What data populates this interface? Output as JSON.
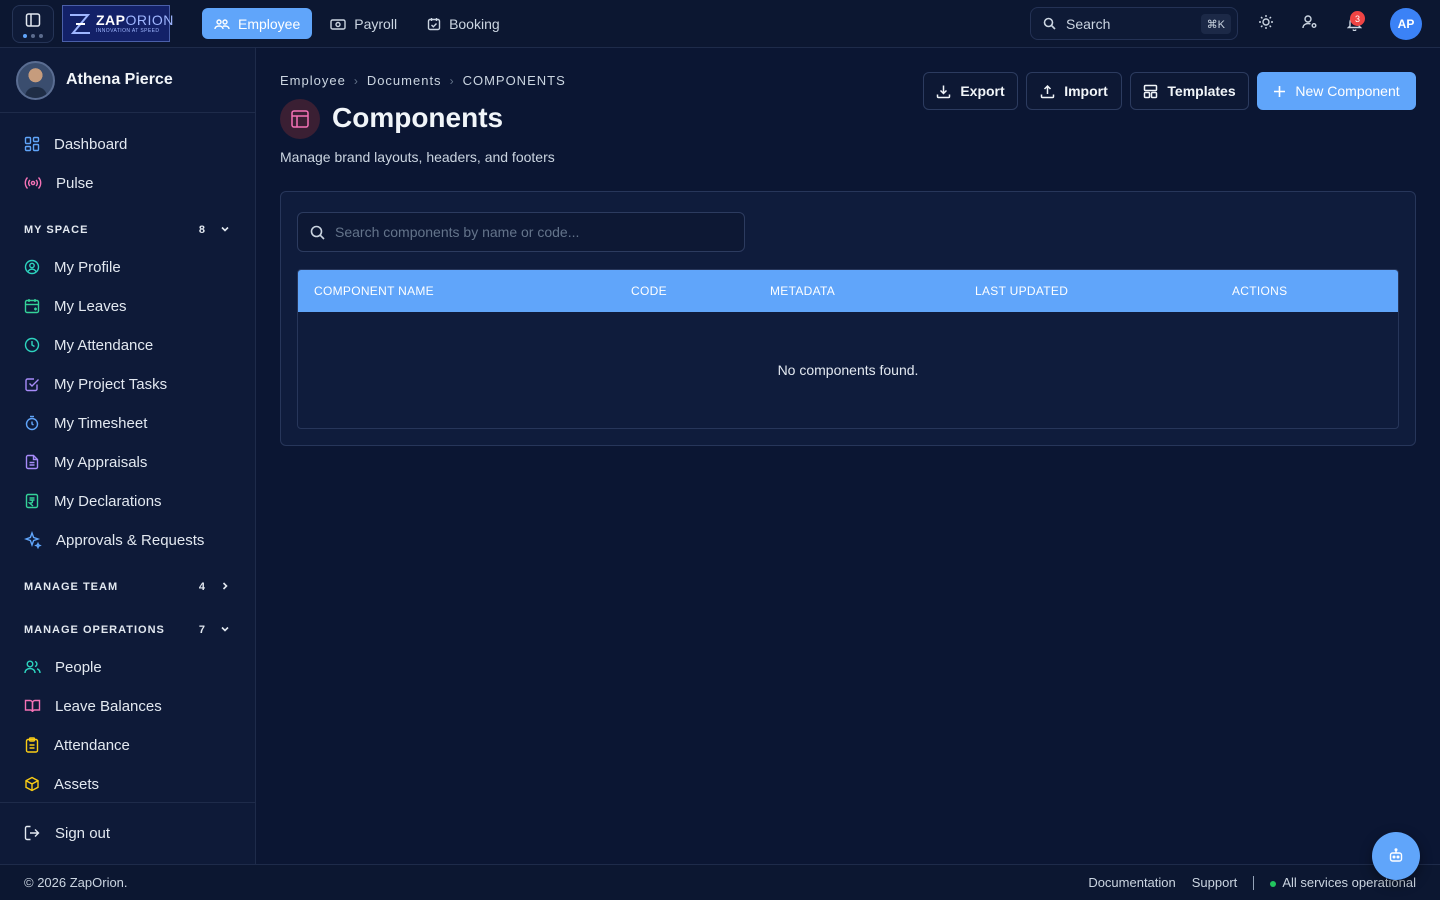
{
  "topbar": {
    "logo": {
      "name_bold": "ZAP",
      "name_rest": "ORION",
      "tagline": "INNOVATION AT SPEED"
    },
    "tabs": [
      {
        "label": "Employee",
        "icon": "users-icon",
        "active": true
      },
      {
        "label": "Payroll",
        "icon": "cash-icon",
        "active": false
      },
      {
        "label": "Booking",
        "icon": "calendar-check-icon",
        "active": false
      }
    ],
    "search": {
      "label": "Search",
      "shortcut": "⌘K"
    },
    "notifications_count": "3",
    "user_initials": "AP"
  },
  "sidebar": {
    "user_name": "Athena Pierce",
    "top_items": [
      {
        "label": "Dashboard",
        "icon": "dashboard-icon"
      },
      {
        "label": "Pulse",
        "icon": "broadcast-icon"
      }
    ],
    "sections": [
      {
        "title": "MY SPACE",
        "count": "8",
        "expanded": true,
        "items": [
          {
            "label": "My Profile",
            "icon": "user-circle-icon"
          },
          {
            "label": "My Leaves",
            "icon": "calendar-plus-icon"
          },
          {
            "label": "My Attendance",
            "icon": "clock-icon"
          },
          {
            "label": "My Project Tasks",
            "icon": "checkbox-icon"
          },
          {
            "label": "My Timesheet",
            "icon": "stopwatch-icon"
          },
          {
            "label": "My Appraisals",
            "icon": "file-text-icon"
          },
          {
            "label": "My Declarations",
            "icon": "rupee-file-icon"
          },
          {
            "label": "Approvals & Requests",
            "icon": "sparkle-icon"
          }
        ]
      },
      {
        "title": "MANAGE TEAM",
        "count": "4",
        "expanded": false,
        "items": []
      },
      {
        "title": "MANAGE OPERATIONS",
        "count": "7",
        "expanded": true,
        "items": [
          {
            "label": "People",
            "icon": "people-icon"
          },
          {
            "label": "Leave Balances",
            "icon": "book-open-icon"
          },
          {
            "label": "Attendance",
            "icon": "clipboard-icon"
          },
          {
            "label": "Assets",
            "icon": "cube-icon"
          }
        ]
      }
    ],
    "sign_out": "Sign out"
  },
  "main": {
    "breadcrumb": [
      "Employee",
      "Documents",
      "COMPONENTS"
    ],
    "title": "Components",
    "subtitle": "Manage brand layouts, headers, and footers",
    "actions": {
      "export": "Export",
      "import": "Import",
      "templates": "Templates",
      "new_component": "New Component"
    },
    "table": {
      "search_placeholder": "Search components by name or code...",
      "columns": [
        "COMPONENT NAME",
        "CODE",
        "METADATA",
        "LAST UPDATED",
        "ACTIONS"
      ],
      "rows": [],
      "empty_message": "No components found."
    }
  },
  "footer": {
    "copyright": "© 2026 ZapOrion.",
    "documentation": "Documentation",
    "support": "Support",
    "status": "All services operational"
  },
  "colors": {
    "accent": "#60a5fa",
    "background": "#0b1633",
    "sidebar": "#0e1a38",
    "badge": "#ef4444",
    "status_ok": "#22c55e"
  }
}
